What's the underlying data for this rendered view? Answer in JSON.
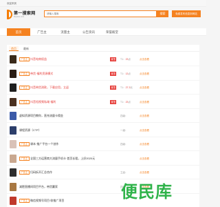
{
  "topbar": {
    "welcome": "欢迎来到"
  },
  "logo": {
    "name": "第一搜索网",
    "sub": "Diyisou.com"
  },
  "search": {
    "placeholder": "请输入搜索",
    "button": "搜索",
    "publish": "免费发布信息到网站"
  },
  "nav": [
    "首页",
    "广告主",
    "流量主",
    "公告资讯",
    "荣誉殿堂"
  ],
  "tabs": [
    "首页",
    "最新"
  ],
  "rows": [
    {
      "tag": "广告主",
      "title": "抖音电商权益",
      "badge": "置顶",
      "meta_prefix": "T1：",
      "meta_num": "23",
      "meta_suffix": "点",
      "action": "点击查看",
      "thumb": "#3a2a1a"
    },
    {
      "tag": "广告主",
      "title": "带货·福利资源模式",
      "badge": "置顶",
      "meta_prefix": "T1：",
      "meta_num": "13",
      "meta_suffix": "点",
      "action": "点击查看",
      "thumb": "#2b1d14"
    },
    {
      "tag": "广告主",
      "title": "抖音带货测款，下载应用，立返",
      "badge": "置顶",
      "meta_prefix": "T1：",
      "meta_num": "27.3",
      "meta_suffix": "元",
      "action": "点击查看",
      "thumb": "#1f1f1f"
    },
    {
      "tag": "广告主",
      "title": "抖音短视频私域·福利",
      "badge": "置顶",
      "meta_prefix": "T1：",
      "meta_num": "23",
      "meta_suffix": "点",
      "action": "点击查看",
      "thumb": "#4a3020"
    },
    {
      "tag": "",
      "title": "虚拟资源项目教你，直充流量卡佣金",
      "badge": "",
      "meta_prefix": "四级：",
      "meta_num": "",
      "meta_suffix": "",
      "action": "点击查看",
      "thumb": "#3b5aa8"
    },
    {
      "tag": "",
      "title": "课程资源（CTP）",
      "badge": "",
      "meta_prefix": "一级：",
      "meta_num": "",
      "meta_suffix": "",
      "action": "点击查看",
      "thumb": "#2c3e6a"
    },
    {
      "tag": "广告主",
      "title": "课本·推广平台一个创作",
      "badge": "",
      "meta_prefix": "四级：",
      "meta_num": "",
      "meta_suffix": "",
      "action": "点击查看",
      "thumb": "#d9c2b8"
    },
    {
      "tag": "广告主",
      "title": "全国三方运营商大流量手机卡·首页长租，上好2020元",
      "badge": "",
      "meta_prefix": "",
      "meta_num": "",
      "meta_suffix": "",
      "action": "点击查看",
      "thumb": "#c9a890"
    },
    {
      "tag": "广告主",
      "title": "扫码拆开汇总合作",
      "badge": "",
      "meta_prefix": "立返：",
      "meta_num": "",
      "meta_suffix": "",
      "action": "点击查看",
      "thumb": "#2d2d2d"
    },
    {
      "tag": "",
      "title": "减肥直播间项目平台，带货赢家",
      "badge": "",
      "meta_prefix": "四级：",
      "meta_num": "",
      "meta_suffix": "",
      "action": "点击查看",
      "thumb": "#a87842"
    },
    {
      "tag": "广告主",
      "title": "微信视频号项目·收推广项目",
      "badge": "",
      "meta_prefix": "",
      "meta_num": "",
      "meta_suffix": "",
      "action": "",
      "thumb": "#c0392b"
    }
  ],
  "watermark": "便民库",
  "colors": {
    "accent": "#f58220",
    "highlight": "#e53935",
    "watermark": "#2fb34a"
  }
}
